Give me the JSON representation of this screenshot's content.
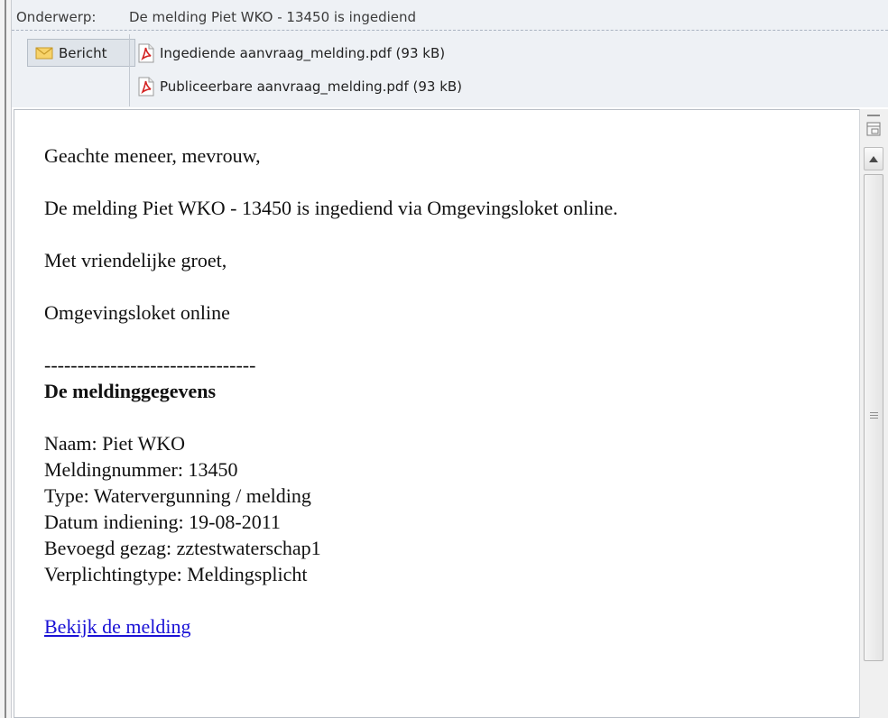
{
  "header": {
    "subject_label": "Onderwerp:",
    "subject_text": "De melding Piet WKO - 13450 is ingediend",
    "message_tab_label": "Bericht",
    "attachments": [
      {
        "label": "Ingediende aanvraag_melding.pdf (93 kB)"
      },
      {
        "label": "Publiceerbare aanvraag_melding.pdf (93 kB)"
      }
    ]
  },
  "body": {
    "greeting": "Geachte meneer, mevrouw,",
    "line1": "De melding Piet WKO - 13450 is ingediend via Omgevingsloket online.",
    "closing": "Met vriendelijke groet,",
    "sender": "Omgevingsloket online",
    "divider": "--------------------------------",
    "section_title": "De meldinggegevens",
    "details": [
      "Naam: Piet WKO",
      "Meldingnummer: 13450",
      "Type: Watervergunning / melding",
      "Datum indiening: 19-08-2011",
      "Bevoegd gezag: zztestwaterschap1",
      "Verplichtingtype: Meldingsplicht"
    ],
    "link_text": "Bekijk de melding"
  },
  "colors": {
    "header_bg": "#eef1f5",
    "link": "#1a12d6",
    "pdf_red": "#d32222"
  }
}
